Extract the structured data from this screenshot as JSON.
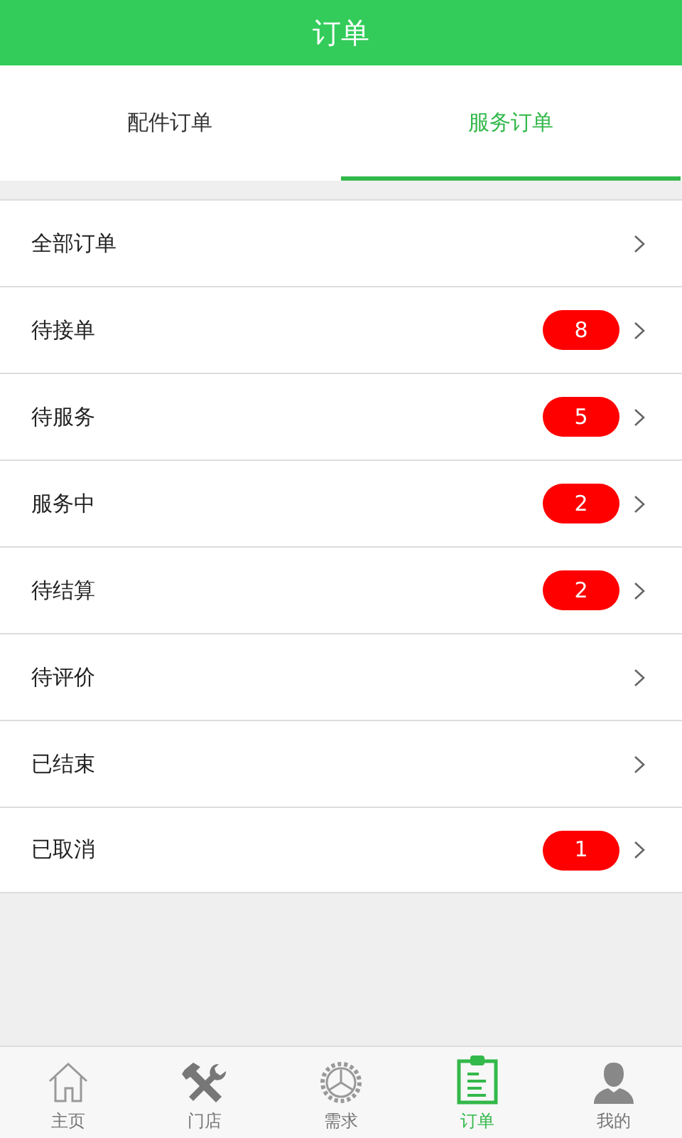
{
  "header": {
    "title": "订单"
  },
  "tabs": [
    {
      "label": "配件订单",
      "selected": false
    },
    {
      "label": "服务订单",
      "selected": true
    }
  ],
  "rows": [
    {
      "label": "全部订单"
    },
    {
      "label": "待接单",
      "badge": "8"
    },
    {
      "label": "待服务",
      "badge": "5"
    },
    {
      "label": "服务中",
      "badge": "2"
    },
    {
      "label": "待结算",
      "badge": "2"
    },
    {
      "label": "待评价"
    },
    {
      "label": "已结束"
    },
    {
      "label": "已取消",
      "badge": "1"
    }
  ],
  "nav": [
    {
      "label": "主页",
      "kind": "home",
      "selected": false
    },
    {
      "label": "门店",
      "kind": "tools",
      "selected": false
    },
    {
      "label": "需求",
      "kind": "gear",
      "selected": false
    },
    {
      "label": "订单",
      "kind": "clipboard",
      "selected": true
    },
    {
      "label": "我的",
      "kind": "user",
      "selected": false
    }
  ]
}
